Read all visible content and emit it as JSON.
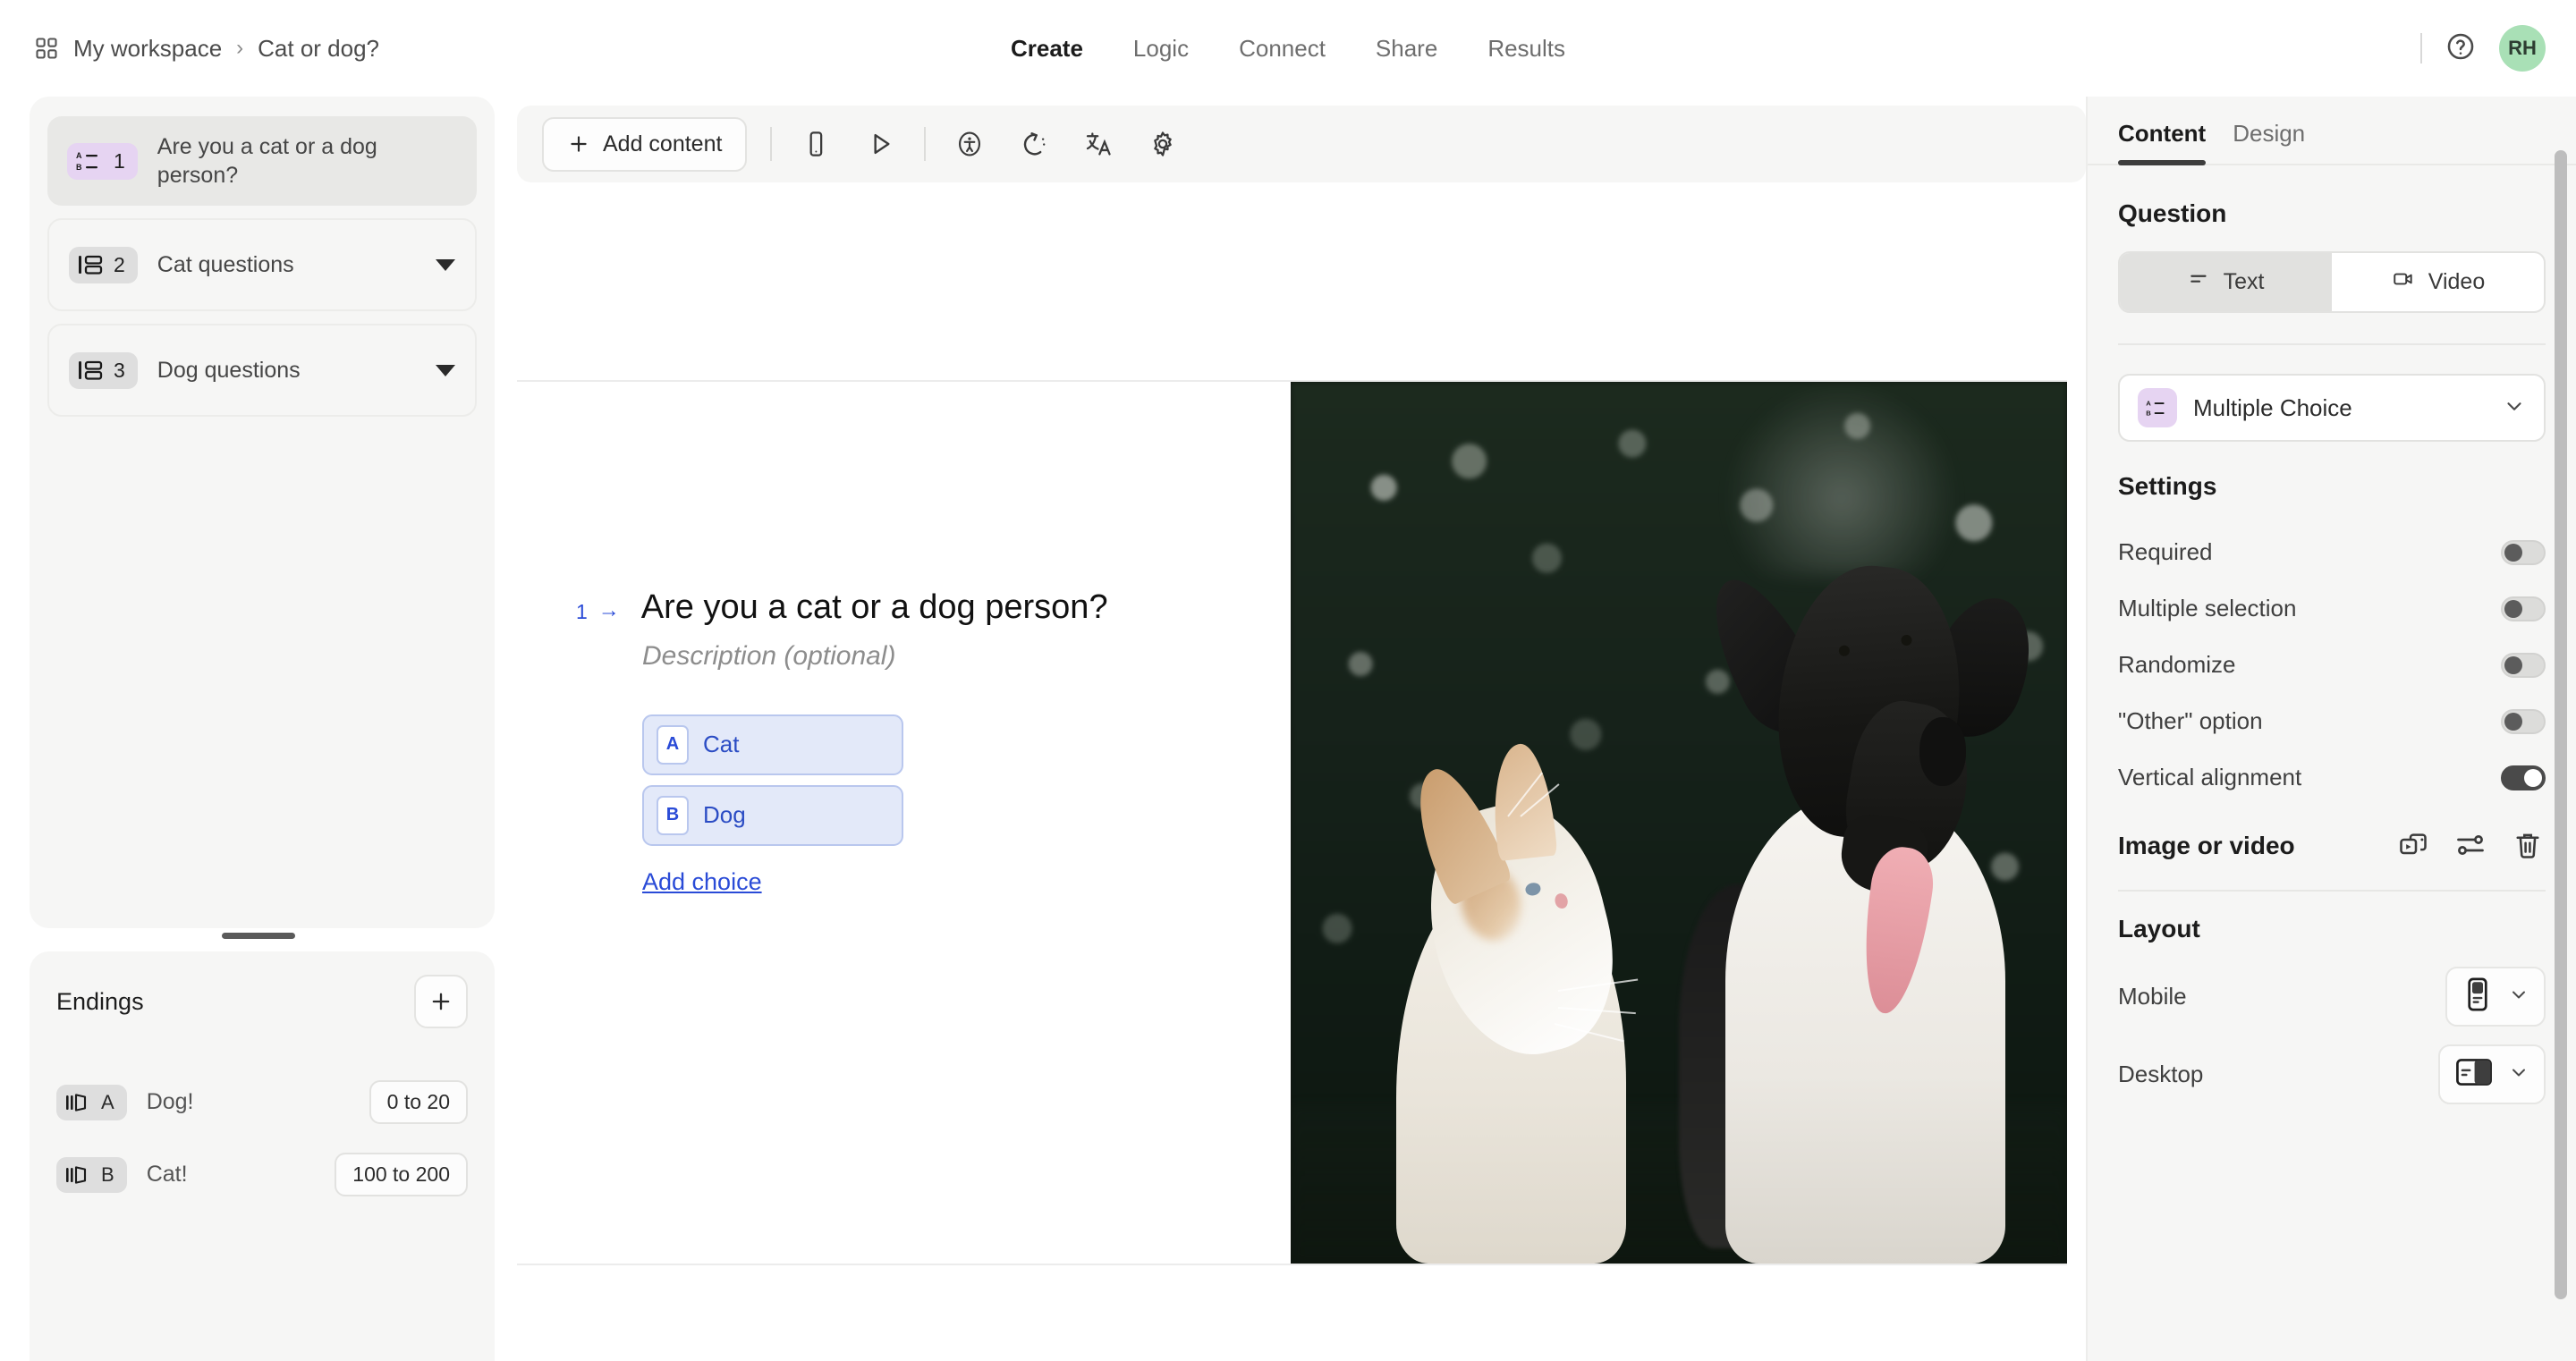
{
  "topbar": {
    "workspace": "My workspace",
    "separator": "›",
    "form_title": "Cat or dog?",
    "grid_icon": "grid-icon",
    "help_icon": "question-mark-icon",
    "avatar_initials": "RH",
    "tabs": [
      {
        "label": "Create",
        "active": true
      },
      {
        "label": "Logic",
        "active": false
      },
      {
        "label": "Connect",
        "active": false
      },
      {
        "label": "Share",
        "active": false
      },
      {
        "label": "Results",
        "active": false
      }
    ]
  },
  "sidebar": {
    "items": [
      {
        "number": "1",
        "label": "Are you a cat or a dog person?",
        "icon": "multiple-choice-icon",
        "selected": true,
        "type": "question"
      },
      {
        "number": "2",
        "label": "Cat questions",
        "icon": "group-icon",
        "selected": false,
        "type": "group"
      },
      {
        "number": "3",
        "label": "Dog questions",
        "icon": "group-icon",
        "selected": false,
        "type": "group"
      }
    ],
    "endings": {
      "title": "Endings",
      "add_icon": "plus-icon",
      "items": [
        {
          "letter": "A",
          "name": "Dog!",
          "range": "0 to 20",
          "icon": "ending-icon"
        },
        {
          "letter": "B",
          "name": "Cat!",
          "range": "100 to 200",
          "icon": "ending-icon"
        }
      ]
    }
  },
  "toolbar": {
    "add_content_label": "Add content",
    "add_content_icon": "plus-icon",
    "icons": [
      {
        "name": "mobile-preview-icon"
      },
      {
        "name": "play-preview-icon"
      },
      {
        "name": "accessibility-icon"
      },
      {
        "name": "undo-icon"
      },
      {
        "name": "translate-icon"
      },
      {
        "name": "gear-icon"
      }
    ]
  },
  "canvas": {
    "question_number": "1",
    "arrow": "→",
    "question_title": "Are you a cat or a dog person?",
    "description_placeholder": "Description (optional)",
    "choices": [
      {
        "letter": "A",
        "text": "Cat"
      },
      {
        "letter": "B",
        "text": "Dog"
      }
    ],
    "add_choice_label": "Add choice",
    "media_alt": "Photo of a tabby cat looking up at a black and white dog with its tongue out, in front of blurred dark green foliage"
  },
  "right_panel": {
    "tabs": [
      {
        "label": "Content",
        "active": true
      },
      {
        "label": "Design",
        "active": false
      }
    ],
    "question_section": {
      "title": "Question",
      "segments": [
        {
          "label": "Text",
          "icon": "text-icon",
          "active": true
        },
        {
          "label": "Video",
          "icon": "video-icon",
          "active": false
        }
      ],
      "type_select": {
        "label": "Multiple Choice",
        "icon": "multiple-choice-icon",
        "chevron": "chevron-down-icon"
      }
    },
    "settings": {
      "title": "Settings",
      "rows": [
        {
          "label": "Required",
          "on": false
        },
        {
          "label": "Multiple selection",
          "on": false
        },
        {
          "label": "Randomize",
          "on": false
        },
        {
          "label": "\"Other\" option",
          "on": false
        },
        {
          "label": "Vertical alignment",
          "on": true
        }
      ]
    },
    "media": {
      "title": "Image or video",
      "icons": [
        {
          "name": "replace-media-icon"
        },
        {
          "name": "adjust-media-icon"
        },
        {
          "name": "trash-icon"
        }
      ]
    },
    "layout": {
      "title": "Layout",
      "rows": [
        {
          "label": "Mobile",
          "icon": "layout-mobile-stacked-icon",
          "chevron": "chevron-down-icon"
        },
        {
          "label": "Desktop",
          "icon": "layout-desktop-split-icon",
          "chevron": "chevron-down-icon"
        }
      ]
    }
  },
  "colors": {
    "accent_purple": "#e6d4f2",
    "choice_blue": "#2a4bd7",
    "choice_bg": "#e3e9f9",
    "avatar_green": "#a9e0b6",
    "panel_bg": "#f6f6f5"
  }
}
